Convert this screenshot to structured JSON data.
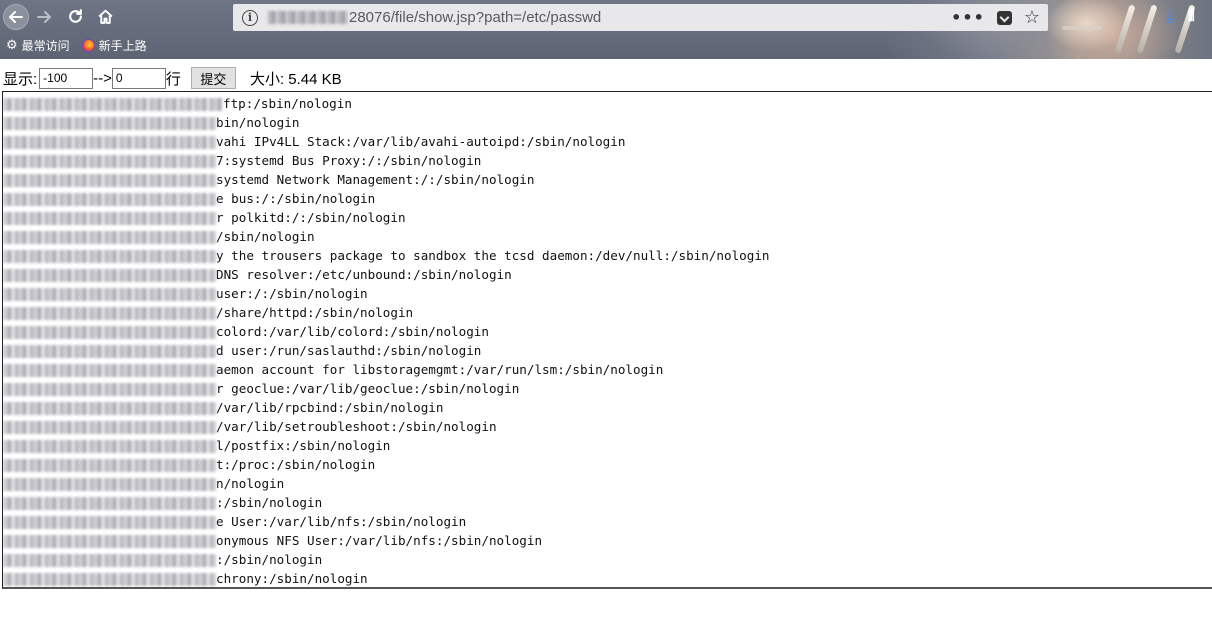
{
  "browser": {
    "url_path": "28076/file/show.jsp?path=/etc/passwd",
    "bookmarks": [
      {
        "label": "最常访问",
        "icon": "gear-icon"
      },
      {
        "label": "新手上路",
        "icon": "firefox-icon"
      }
    ]
  },
  "form": {
    "show_label": "显示:",
    "from_value": "-100",
    "arrow_label": "-->",
    "to_value": "0",
    "unit_label": "行",
    "submit_label": "提交",
    "size_label": "大小: 5.44 KB"
  },
  "file_lines": [
    {
      "visible": "ftp:/sbin/nologin",
      "redact_chars": 29
    },
    {
      "visible": "bin/nologin",
      "redact_chars": 28
    },
    {
      "visible": "vahi IPv4LL Stack:/var/lib/avahi-autoipd:/sbin/nologin",
      "redact_chars": 28
    },
    {
      "visible": "7:systemd Bus Proxy:/:/sbin/nologin",
      "redact_chars": 28
    },
    {
      "visible": "systemd Network Management:/:/sbin/nologin",
      "redact_chars": 28
    },
    {
      "visible": "e bus:/:/sbin/nologin",
      "redact_chars": 28
    },
    {
      "visible": "r polkitd:/:/sbin/nologin",
      "redact_chars": 28
    },
    {
      "visible": "/sbin/nologin",
      "redact_chars": 28
    },
    {
      "visible": "y the trousers package to sandbox the tcsd daemon:/dev/null:/sbin/nologin",
      "redact_chars": 28
    },
    {
      "visible": "DNS resolver:/etc/unbound:/sbin/nologin",
      "redact_chars": 28
    },
    {
      "visible": "user:/:/sbin/nologin",
      "redact_chars": 28
    },
    {
      "visible": "/share/httpd:/sbin/nologin",
      "redact_chars": 28
    },
    {
      "visible": "colord:/var/lib/colord:/sbin/nologin",
      "redact_chars": 28
    },
    {
      "visible": "d user:/run/saslauthd:/sbin/nologin",
      "redact_chars": 28
    },
    {
      "visible": "aemon account for libstoragemgmt:/var/run/lsm:/sbin/nologin",
      "redact_chars": 28
    },
    {
      "visible": "r geoclue:/var/lib/geoclue:/sbin/nologin",
      "redact_chars": 28
    },
    {
      "visible": "/var/lib/rpcbind:/sbin/nologin",
      "redact_chars": 28
    },
    {
      "visible": "/var/lib/setroubleshoot:/sbin/nologin",
      "redact_chars": 28
    },
    {
      "visible": "l/postfix:/sbin/nologin",
      "redact_chars": 28
    },
    {
      "visible": "t:/proc:/sbin/nologin",
      "redact_chars": 28
    },
    {
      "visible": "n/nologin",
      "redact_chars": 28
    },
    {
      "visible": ":/sbin/nologin",
      "redact_chars": 28
    },
    {
      "visible": "e User:/var/lib/nfs:/sbin/nologin",
      "redact_chars": 28
    },
    {
      "visible": "onymous NFS User:/var/lib/nfs:/sbin/nologin",
      "redact_chars": 28
    },
    {
      "visible": ":/sbin/nologin",
      "redact_chars": 28
    },
    {
      "visible": "chrony:/sbin/nologin",
      "redact_chars": 28
    }
  ]
}
